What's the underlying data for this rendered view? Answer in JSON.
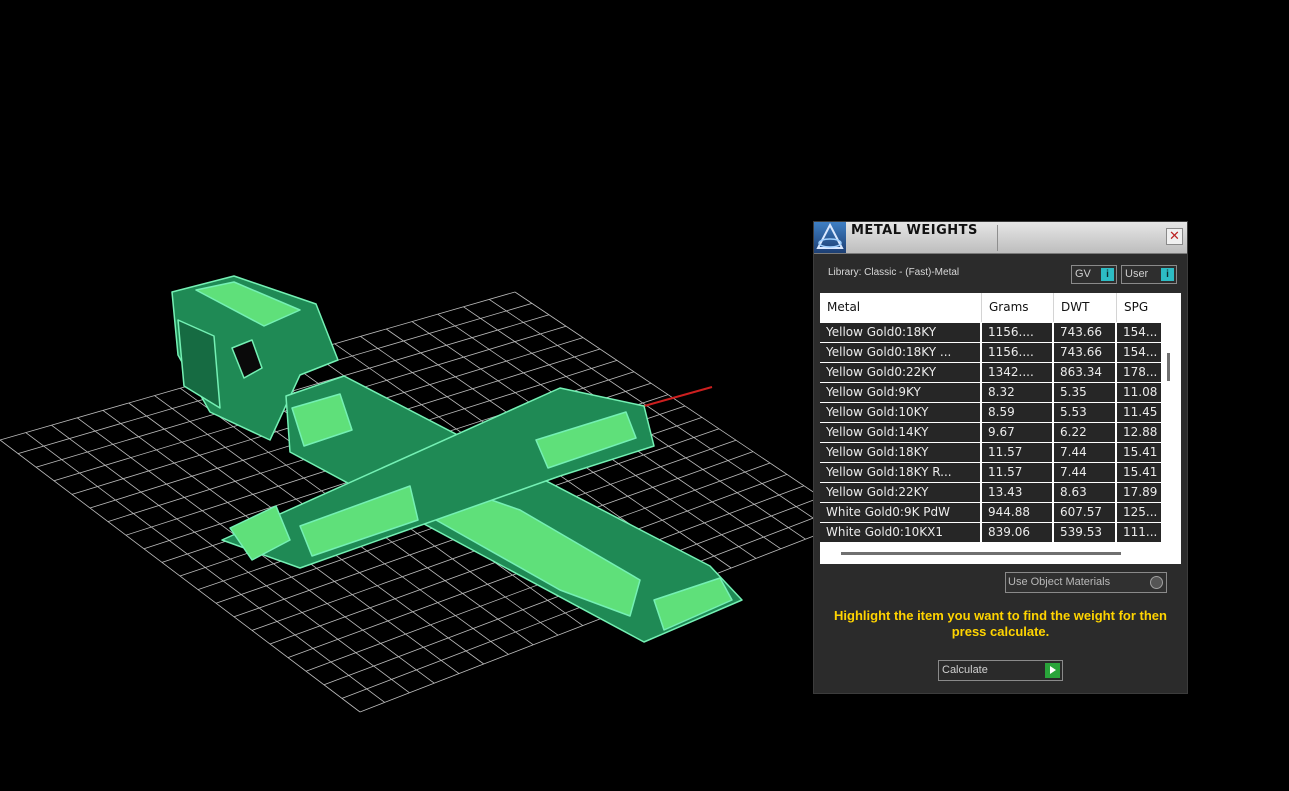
{
  "panel": {
    "title": "METAL WEIGHTS",
    "close_glyph": "✕",
    "library_label": "Library: Classic - (Fast)-Metal",
    "chips": [
      {
        "label": "GV",
        "icon": "info-icon",
        "icon_glyph": "i"
      },
      {
        "label": "User",
        "icon": "info-icon",
        "icon_glyph": "i"
      }
    ],
    "table": {
      "headers": [
        "Metal",
        "Grams",
        "DWT",
        "SPG"
      ],
      "rows": [
        [
          "Yellow Gold0:18KY",
          "1156....",
          "743.66",
          "154..."
        ],
        [
          "Yellow Gold0:18KY ...",
          "1156....",
          "743.66",
          "154..."
        ],
        [
          "Yellow Gold0:22KY",
          "1342....",
          "863.34",
          "178..."
        ],
        [
          "Yellow Gold:9KY",
          "8.32",
          "5.35",
          "11.08"
        ],
        [
          "Yellow Gold:10KY",
          "8.59",
          "5.53",
          "11.45"
        ],
        [
          "Yellow Gold:14KY",
          "9.67",
          "6.22",
          "12.88"
        ],
        [
          "Yellow Gold:18KY",
          "11.57",
          "7.44",
          "15.41"
        ],
        [
          "Yellow Gold:18KY R...",
          "11.57",
          "7.44",
          "15.41"
        ],
        [
          "Yellow Gold:22KY",
          "13.43",
          "8.63",
          "17.89"
        ],
        [
          "White Gold0:9K PdW",
          "944.88",
          "607.57",
          "125..."
        ],
        [
          "White Gold0:10KX1",
          "839.06",
          "539.53",
          "111..."
        ]
      ]
    },
    "use_object_materials": "Use Object Materials",
    "hint": "Highlight the item you want to find the weight for then press calculate.",
    "calculate_label": "Calculate"
  },
  "colors": {
    "background": "#000000",
    "grid": "#bdbdbd",
    "model_fill": "#1f8a55",
    "model_highlight": "#5fe07a",
    "model_edge": "#74f0b4",
    "axis_x": "#cc1f1f",
    "hint_text": "#ffd400",
    "accent_teal": "#2dbcc4",
    "calculate_go": "#29a43a"
  }
}
